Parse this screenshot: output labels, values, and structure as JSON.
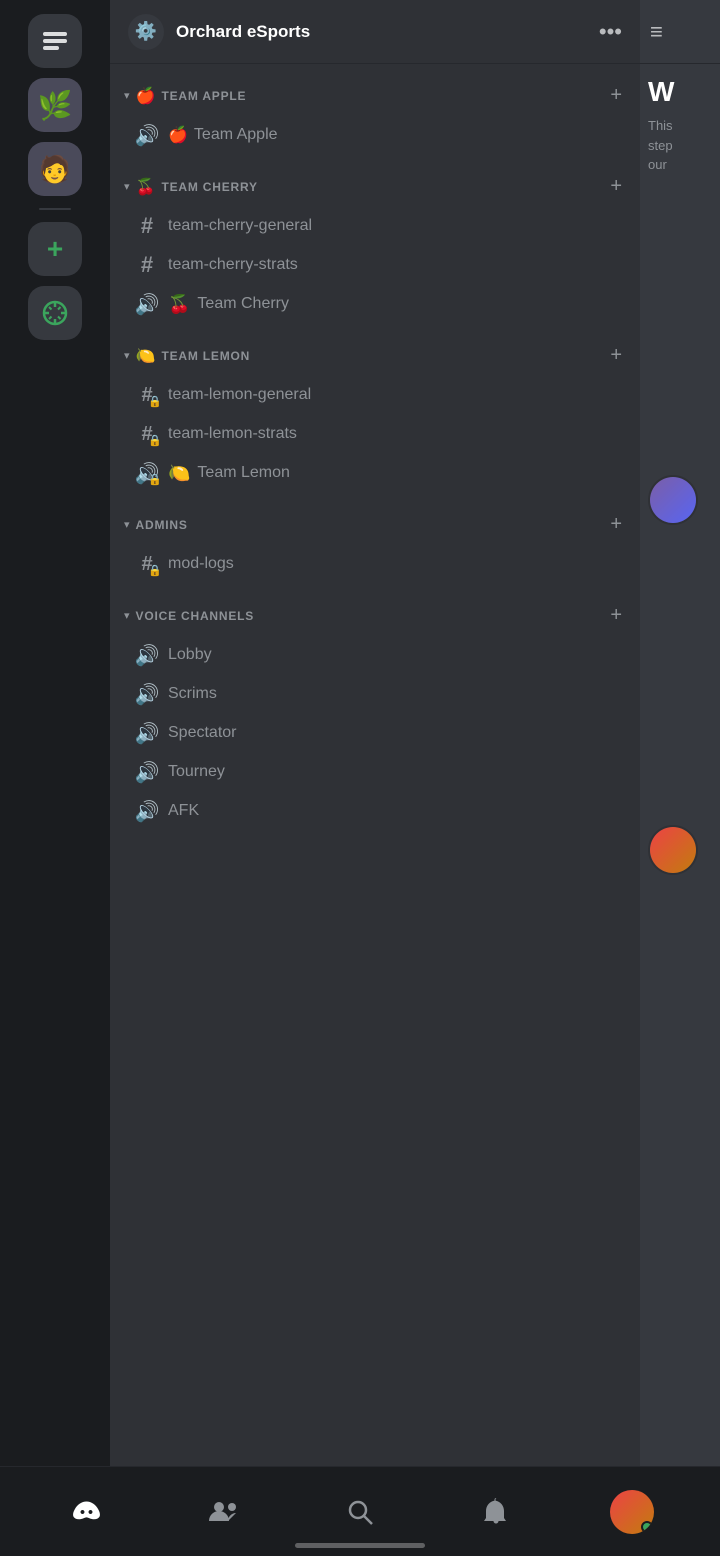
{
  "server": {
    "name": "Orchard eSports",
    "header_icon": "⚙️"
  },
  "categories": [
    {
      "id": "team-apple",
      "name": "TEAM APPLE",
      "emoji": "🍎",
      "collapsed": false,
      "channels": [
        {
          "id": "team-apple-ch",
          "name": "Team Apple",
          "type": "text",
          "locked": false
        }
      ]
    },
    {
      "id": "team-cherry",
      "name": "TEAM CHERRY",
      "emoji": "🍒",
      "collapsed": false,
      "channels": [
        {
          "id": "team-cherry-general",
          "name": "team-cherry-general",
          "type": "text",
          "locked": false
        },
        {
          "id": "team-cherry-strats",
          "name": "team-cherry-strats",
          "type": "text",
          "locked": false
        },
        {
          "id": "team-cherry-voice",
          "name": "Team Cherry",
          "type": "voice",
          "locked": false,
          "emoji": "🍒"
        }
      ]
    },
    {
      "id": "team-lemon",
      "name": "TEAM LEMON",
      "emoji": "🍋",
      "collapsed": false,
      "channels": [
        {
          "id": "team-lemon-general",
          "name": "team-lemon-general",
          "type": "text",
          "locked": true
        },
        {
          "id": "team-lemon-strats",
          "name": "team-lemon-strats",
          "type": "text",
          "locked": true
        },
        {
          "id": "team-lemon-voice",
          "name": "Team Lemon",
          "type": "voice",
          "locked": false,
          "emoji": "🍋"
        }
      ]
    },
    {
      "id": "admins",
      "name": "ADMINS",
      "emoji": "",
      "collapsed": false,
      "channels": [
        {
          "id": "mod-logs",
          "name": "mod-logs",
          "type": "text",
          "locked": true
        }
      ]
    },
    {
      "id": "voice-channels",
      "name": "VOICE CHANNELS",
      "emoji": "",
      "collapsed": false,
      "channels": [
        {
          "id": "lobby",
          "name": "Lobby",
          "type": "voice",
          "locked": false
        },
        {
          "id": "scrims",
          "name": "Scrims",
          "type": "voice",
          "locked": false
        },
        {
          "id": "spectator",
          "name": "Spectator",
          "type": "voice",
          "locked": false
        },
        {
          "id": "tourney",
          "name": "Tourney",
          "type": "voice",
          "locked": false
        },
        {
          "id": "afk",
          "name": "AFK",
          "type": "voice",
          "locked": false
        }
      ]
    }
  ],
  "right_panel": {
    "title": "W",
    "text": "This step our"
  },
  "bottom_nav": {
    "items": [
      {
        "id": "home",
        "label": "Home",
        "icon": "discord"
      },
      {
        "id": "friends",
        "label": "Friends",
        "icon": "friends"
      },
      {
        "id": "search",
        "label": "Search",
        "icon": "search"
      },
      {
        "id": "notifications",
        "label": "Notifications",
        "icon": "bell"
      },
      {
        "id": "profile",
        "label": "Profile",
        "icon": "avatar"
      }
    ]
  }
}
